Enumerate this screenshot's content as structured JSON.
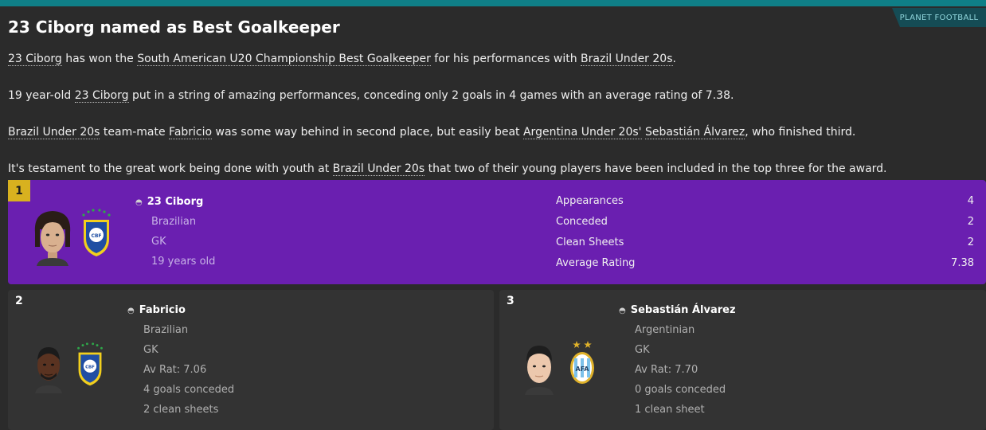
{
  "header": {
    "tag": "PLANET FOOTBALL"
  },
  "article": {
    "title": "23 Ciborg named as Best Goalkeeper",
    "p1": {
      "player": "23 Ciborg",
      "t1": " has won the ",
      "award": "South American U20 Championship Best Goalkeeper",
      "t2": " for his performances with ",
      "team": "Brazil Under 20s",
      "t3": "."
    },
    "p2": {
      "t1": "19 year-old ",
      "player": "23 Ciborg",
      "t2": " put in a string of amazing performances, conceding only 2 goals in 4 games with an average rating of 7.38."
    },
    "p3": {
      "team": "Brazil Under 20s",
      "t1": " team-mate ",
      "player2": "Fabricio",
      "t2": " was some way behind in second place, but easily beat ",
      "team2": "Argentina Under 20s'",
      "t3": " ",
      "player3": "Sebastián Álvarez",
      "t4": ", who finished third."
    },
    "p4": {
      "t1": "It's testament to the great work being done with youth at ",
      "team": "Brazil Under 20s",
      "t2": " that two of their young players have been included in the top three for the award."
    }
  },
  "winner": {
    "rank": "1",
    "name": "23 Ciborg",
    "nationality": "Brazilian",
    "position": "GK",
    "age": "19 years old",
    "stats": [
      {
        "label": "Appearances",
        "value": "4"
      },
      {
        "label": "Conceded",
        "value": "2"
      },
      {
        "label": "Clean Sheets",
        "value": "2"
      },
      {
        "label": "Average Rating",
        "value": "7.38"
      }
    ]
  },
  "runners_up": [
    {
      "rank": "2",
      "name": "Fabricio",
      "nationality": "Brazilian",
      "position": "GK",
      "rating": "Av Rat: 7.06",
      "conceded": "4 goals conceded",
      "clean": "2 clean sheets"
    },
    {
      "rank": "3",
      "name": "Sebastián Álvarez",
      "nationality": "Argentinian",
      "position": "GK",
      "rating": "Av Rat: 7.70",
      "conceded": "0 goals conceded",
      "clean": "1 clean sheet"
    }
  ],
  "icons": {
    "person": "person-icon",
    "brazil": "cbf-badge-icon",
    "argentina": "afa-badge-icon"
  },
  "colors": {
    "accent": "#0f7f87",
    "winner_bg": "#6a1fb0",
    "rank_gold": "#d8b11f"
  }
}
